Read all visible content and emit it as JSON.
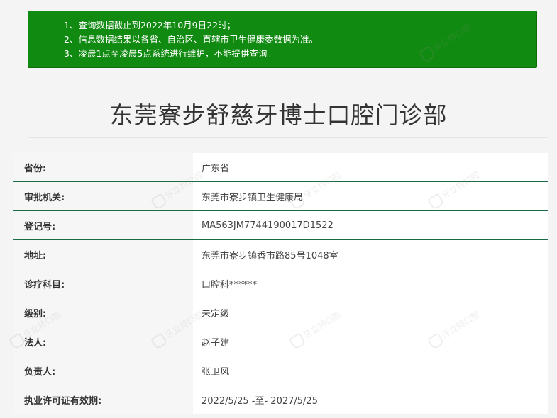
{
  "notice": {
    "lines": [
      "1、查询数据截止到2022年10月9日22时；",
      "2、信息数据结果以各省、自治区、直辖市卫生健康委数据为准。",
      "3、凌晨1点至凌晨5点系统进行维护，不能提供查询。"
    ]
  },
  "title": "东莞寮步舒慈牙博士口腔门诊部",
  "details": [
    {
      "label": "省份:",
      "value": "广东省"
    },
    {
      "label": "审批机关:",
      "value": "东莞市寮步镇卫生健康局"
    },
    {
      "label": "登记号:",
      "value": "MA563JM7744190017D1522"
    },
    {
      "label": "地址:",
      "value": "东莞市寮步镇香市路85号1048室"
    },
    {
      "label": "诊疗科目:",
      "value": "口腔科******"
    },
    {
      "label": "级别:",
      "value": "未定级"
    },
    {
      "label": "法人:",
      "value": "赵子建"
    },
    {
      "label": "负责人:",
      "value": "张卫风"
    },
    {
      "label": "执业许可证有效期:",
      "value": "2022/5/25 -至- 2027/5/25"
    }
  ],
  "watermark": {
    "text": "牙立特口腔",
    "icon": "tooth-logo-icon"
  },
  "colors": {
    "notice_bg": "#118a11",
    "row_border": "#1c6b45"
  }
}
